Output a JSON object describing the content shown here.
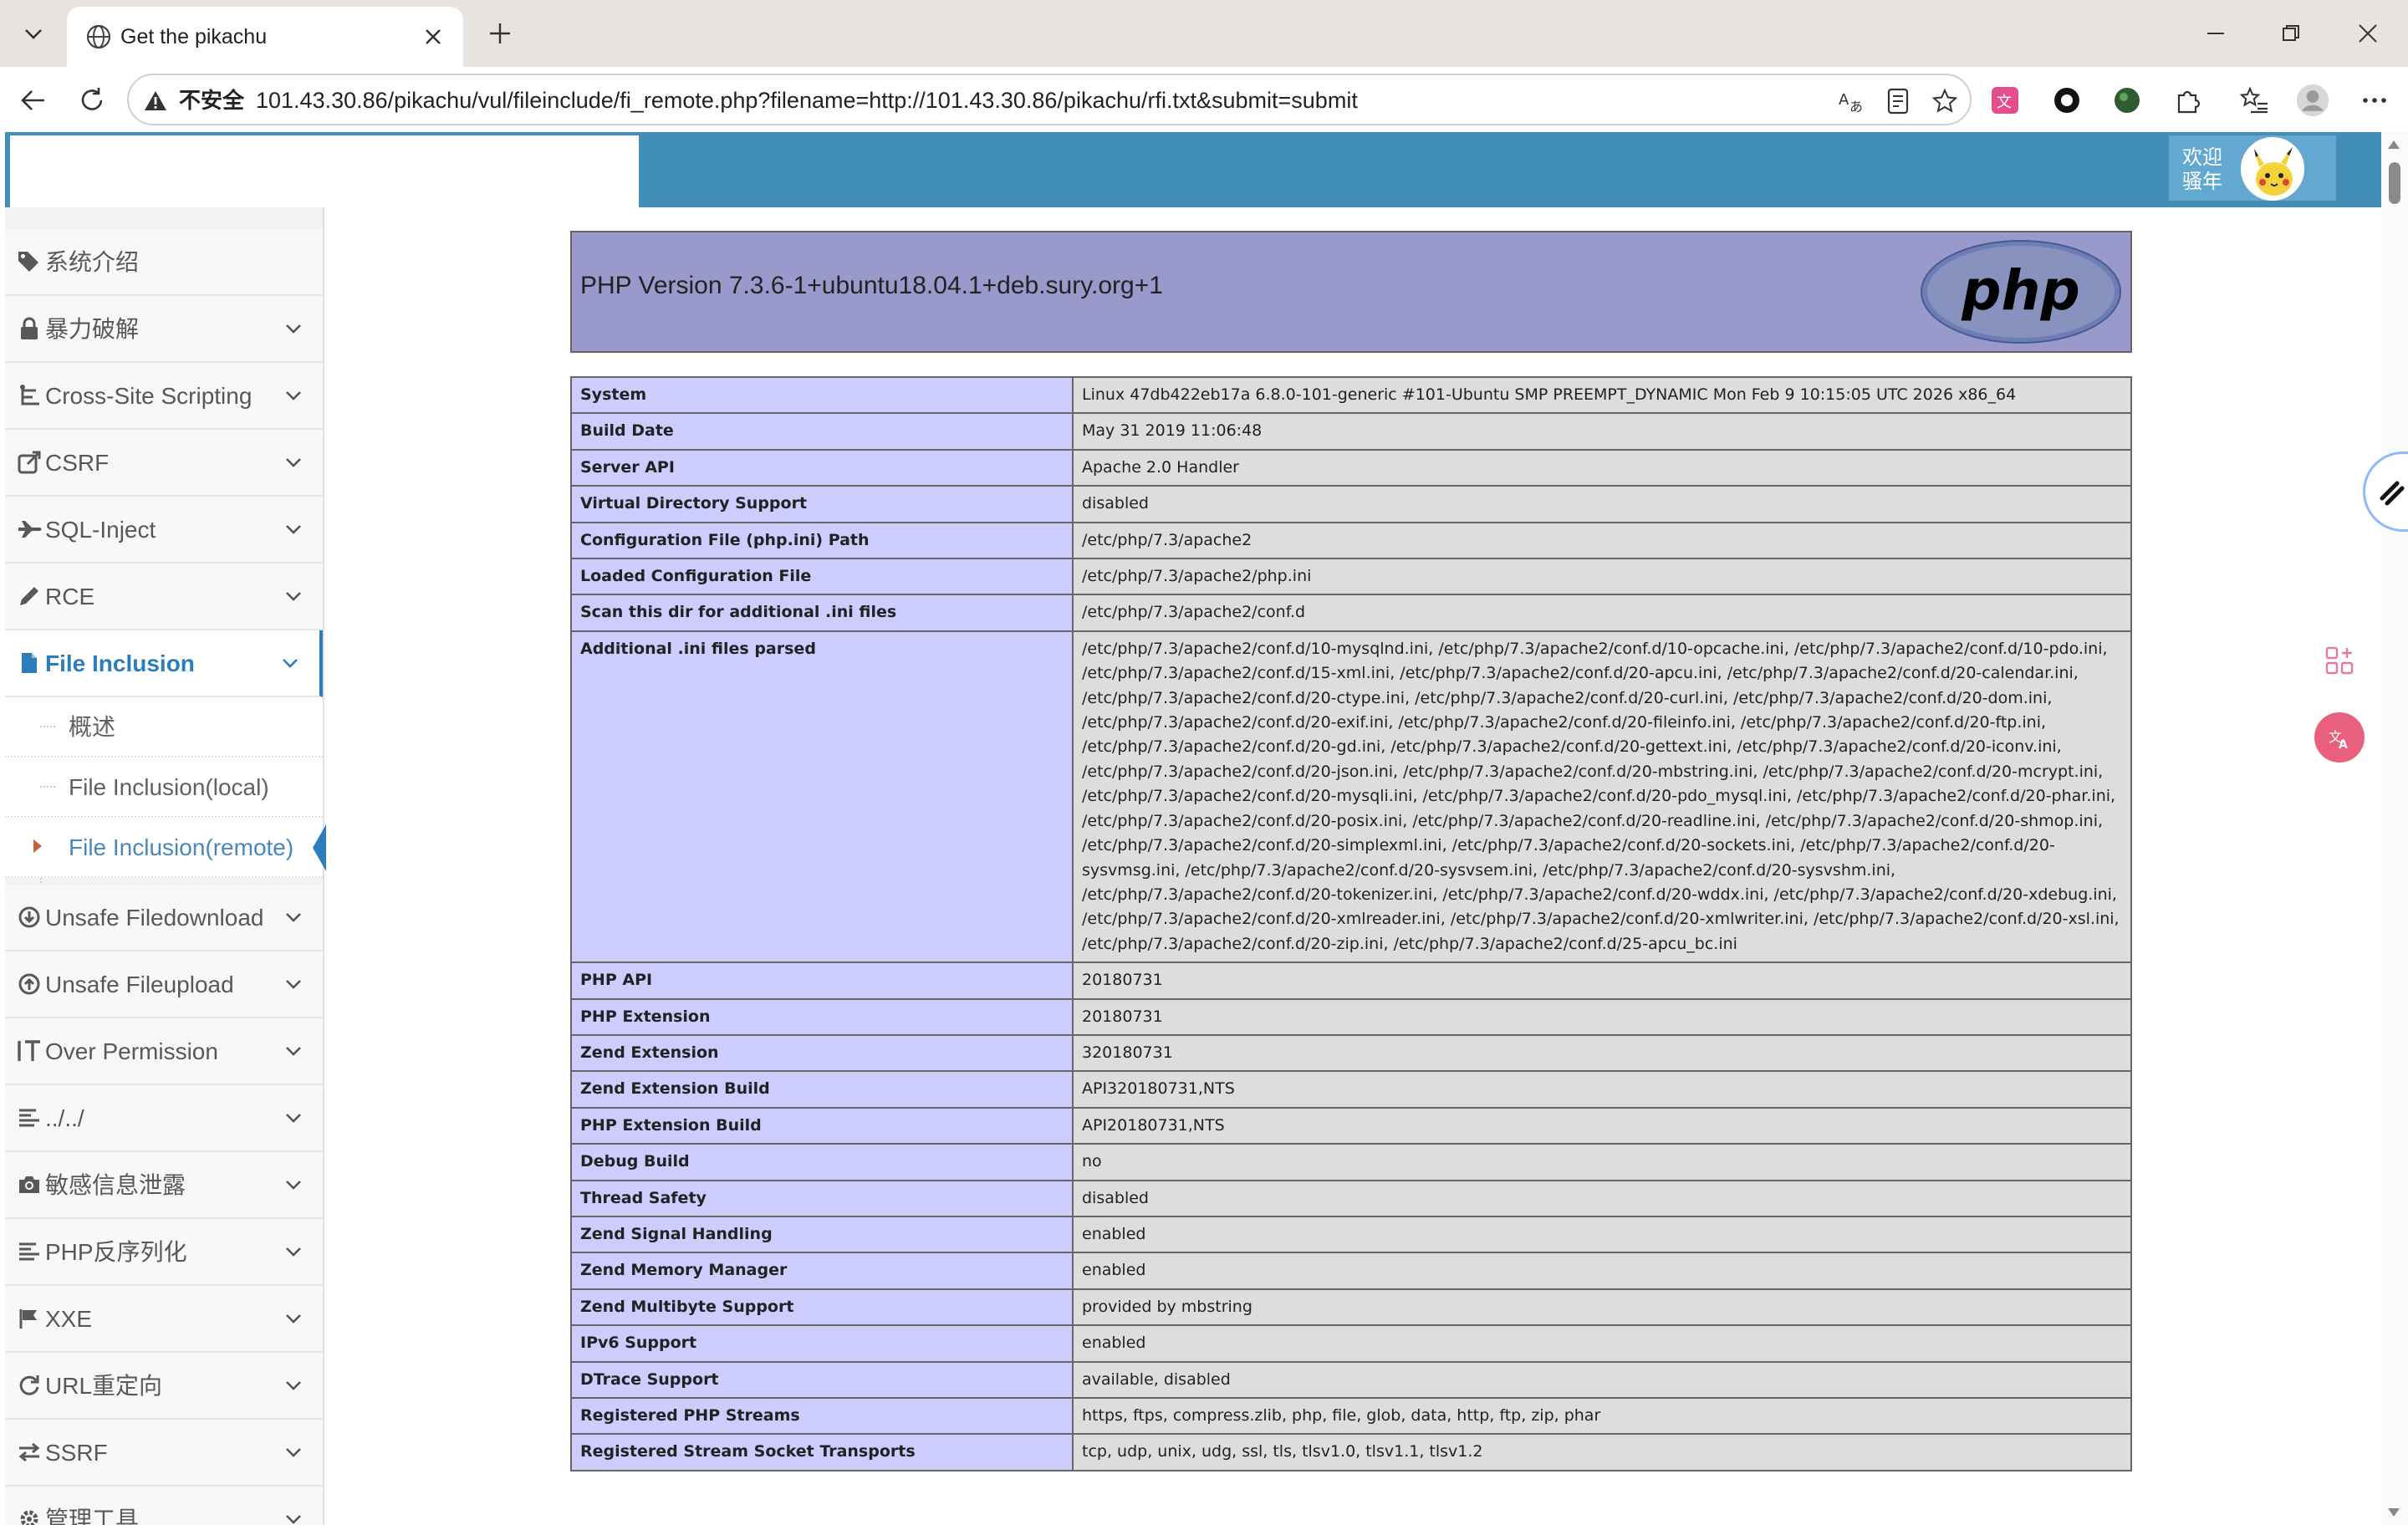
{
  "browser": {
    "tab_title": "Get the pikachu",
    "insecure_label": "不安全",
    "url": "101.43.30.86/pikachu/vul/fileinclude/fi_remote.php?filename=http://101.43.30.86/pikachu/rfi.txt&submit=submit"
  },
  "header": {
    "welcome_line1": "欢迎",
    "welcome_line2": "骚年"
  },
  "sidebar": {
    "items": [
      {
        "label": "系统介绍",
        "icon": "tags-icon"
      },
      {
        "label": "暴力破解",
        "icon": "lock-icon"
      },
      {
        "label": "Cross-Site Scripting",
        "icon": "sitemap-icon"
      },
      {
        "label": "CSRF",
        "icon": "share-icon"
      },
      {
        "label": "SQL-Inject",
        "icon": "fighter-jet-icon"
      },
      {
        "label": "RCE",
        "icon": "pencil-icon"
      },
      {
        "label": "File Inclusion",
        "icon": "file-icon"
      },
      {
        "label": "Unsafe Filedownload",
        "icon": "download-icon"
      },
      {
        "label": "Unsafe Fileupload",
        "icon": "upload-icon"
      },
      {
        "label": "Over Permission",
        "icon": "text-height-icon"
      },
      {
        "label": "../../",
        "icon": "align-left-icon"
      },
      {
        "label": "敏感信息泄露",
        "icon": "camera-icon"
      },
      {
        "label": "PHP反序列化",
        "icon": "align-left-icon"
      },
      {
        "label": "XXE",
        "icon": "flag-icon"
      },
      {
        "label": "URL重定向",
        "icon": "refresh-icon"
      },
      {
        "label": "SSRF",
        "icon": "exchange-icon"
      },
      {
        "label": "管理工具",
        "icon": "cog-icon"
      }
    ],
    "subitems": [
      {
        "label": "概述"
      },
      {
        "label": "File Inclusion(local)"
      },
      {
        "label": "File Inclusion(remote)"
      }
    ]
  },
  "phpinfo": {
    "version": "PHP Version 7.3.6-1+ubuntu18.04.1+deb.sury.org+1",
    "logo_text": "php",
    "rows": [
      {
        "k": "System",
        "v": "Linux 47db422eb17a 6.8.0-101-generic #101-Ubuntu SMP PREEMPT_DYNAMIC Mon Feb 9 10:15:05 UTC 2026 x86_64"
      },
      {
        "k": "Build Date",
        "v": "May 31 2019 11:06:48"
      },
      {
        "k": "Server API",
        "v": "Apache 2.0 Handler"
      },
      {
        "k": "Virtual Directory Support",
        "v": "disabled"
      },
      {
        "k": "Configuration File (php.ini) Path",
        "v": "/etc/php/7.3/apache2"
      },
      {
        "k": "Loaded Configuration File",
        "v": "/etc/php/7.3/apache2/php.ini"
      },
      {
        "k": "Scan this dir for additional .ini files",
        "v": "/etc/php/7.3/apache2/conf.d"
      },
      {
        "k": "Additional .ini files parsed",
        "v": "/etc/php/7.3/apache2/conf.d/10-mysqlnd.ini, /etc/php/7.3/apache2/conf.d/10-opcache.ini, /etc/php/7.3/apache2/conf.d/10-pdo.ini, /etc/php/7.3/apache2/conf.d/15-xml.ini, /etc/php/7.3/apache2/conf.d/20-apcu.ini, /etc/php/7.3/apache2/conf.d/20-calendar.ini, /etc/php/7.3/apache2/conf.d/20-ctype.ini, /etc/php/7.3/apache2/conf.d/20-curl.ini, /etc/php/7.3/apache2/conf.d/20-dom.ini, /etc/php/7.3/apache2/conf.d/20-exif.ini, /etc/php/7.3/apache2/conf.d/20-fileinfo.ini, /etc/php/7.3/apache2/conf.d/20-ftp.ini, /etc/php/7.3/apache2/conf.d/20-gd.ini, /etc/php/7.3/apache2/conf.d/20-gettext.ini, /etc/php/7.3/apache2/conf.d/20-iconv.ini, /etc/php/7.3/apache2/conf.d/20-json.ini, /etc/php/7.3/apache2/conf.d/20-mbstring.ini, /etc/php/7.3/apache2/conf.d/20-mcrypt.ini, /etc/php/7.3/apache2/conf.d/20-mysqli.ini, /etc/php/7.3/apache2/conf.d/20-pdo_mysql.ini, /etc/php/7.3/apache2/conf.d/20-phar.ini, /etc/php/7.3/apache2/conf.d/20-posix.ini, /etc/php/7.3/apache2/conf.d/20-readline.ini, /etc/php/7.3/apache2/conf.d/20-shmop.ini, /etc/php/7.3/apache2/conf.d/20-simplexml.ini, /etc/php/7.3/apache2/conf.d/20-sockets.ini, /etc/php/7.3/apache2/conf.d/20-sysvmsg.ini, /etc/php/7.3/apache2/conf.d/20-sysvsem.ini, /etc/php/7.3/apache2/conf.d/20-sysvshm.ini, /etc/php/7.3/apache2/conf.d/20-tokenizer.ini, /etc/php/7.3/apache2/conf.d/20-wddx.ini, /etc/php/7.3/apache2/conf.d/20-xdebug.ini, /etc/php/7.3/apache2/conf.d/20-xmlreader.ini, /etc/php/7.3/apache2/conf.d/20-xmlwriter.ini, /etc/php/7.3/apache2/conf.d/20-xsl.ini, /etc/php/7.3/apache2/conf.d/20-zip.ini, /etc/php/7.3/apache2/conf.d/25-apcu_bc.ini"
      },
      {
        "k": "PHP API",
        "v": "20180731"
      },
      {
        "k": "PHP Extension",
        "v": "20180731"
      },
      {
        "k": "Zend Extension",
        "v": "320180731"
      },
      {
        "k": "Zend Extension Build",
        "v": "API320180731,NTS"
      },
      {
        "k": "PHP Extension Build",
        "v": "API20180731,NTS"
      },
      {
        "k": "Debug Build",
        "v": "no"
      },
      {
        "k": "Thread Safety",
        "v": "disabled"
      },
      {
        "k": "Zend Signal Handling",
        "v": "enabled"
      },
      {
        "k": "Zend Memory Manager",
        "v": "enabled"
      },
      {
        "k": "Zend Multibyte Support",
        "v": "provided by mbstring"
      },
      {
        "k": "IPv6 Support",
        "v": "enabled"
      },
      {
        "k": "DTrace Support",
        "v": "available, disabled"
      },
      {
        "k": "Registered PHP Streams",
        "v": "https, ftps, compress.zlib, php, file, glob, data, http, ftp, zip, phar"
      },
      {
        "k": "Registered Stream Socket Transports",
        "v": "tcp, udp, unix, udg, ssl, tls, tlsv1.0, tlsv1.1, tlsv1.2"
      }
    ]
  },
  "colors": {
    "header_blue": "#438eb9",
    "php_purple": "#9999cc",
    "key_cell": "#ccccff",
    "value_cell": "#dddddd",
    "sidebar_active": "#2b7dbc"
  }
}
